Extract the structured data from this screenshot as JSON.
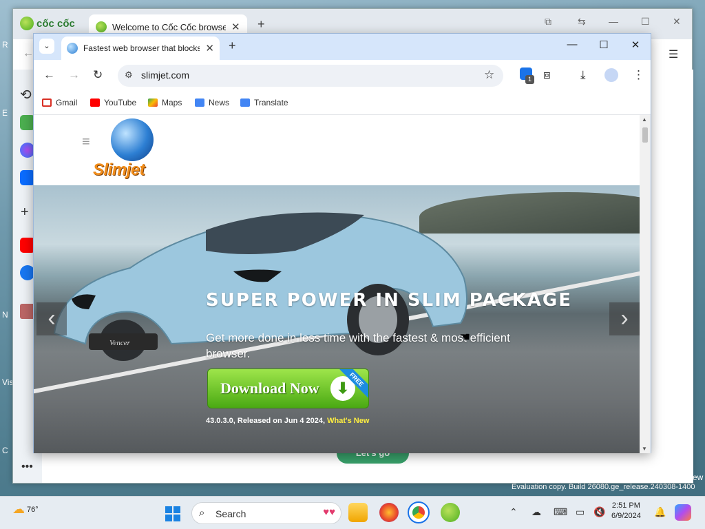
{
  "desktop": {
    "left_chars": [
      "R",
      "E",
      "N",
      "Vis",
      "C"
    ],
    "right_label": "ew",
    "evaluation": "Evaluation copy. Build 26080.ge_release.240308-1400"
  },
  "coccoc": {
    "logo_text": "cốc cốc",
    "tab_title": "Welcome to Cốc Cốc browser",
    "letsgo": "Let's go"
  },
  "slimjet": {
    "tab_title": "Fastest web browser that blocks ads",
    "url": "slimjet.com",
    "extensions_badge": "1",
    "bookmarks": [
      {
        "label": "Gmail",
        "color": "#d93025"
      },
      {
        "label": "YouTube",
        "color": "#ff0000"
      },
      {
        "label": "Maps",
        "color": "#34a853"
      },
      {
        "label": "News",
        "color": "#4285f4"
      },
      {
        "label": "Translate",
        "color": "#4285f4"
      }
    ]
  },
  "site": {
    "logo_text": "Slimjet",
    "hero_title": "SUPER POWER IN SLIM PACKAGE",
    "hero_sub": "Get more done in less time with the fastest & most efficient browser.",
    "download_label": "Download Now",
    "free_badge": "FREE",
    "version_text": "43.0.3.0, Released on Jun 4 2024,",
    "whats_new": "What's New",
    "car_badge": "Vencer"
  },
  "taskbar": {
    "temperature": "76°",
    "search_placeholder": "Search",
    "time": "2:51 PM",
    "date": "6/9/2024"
  }
}
